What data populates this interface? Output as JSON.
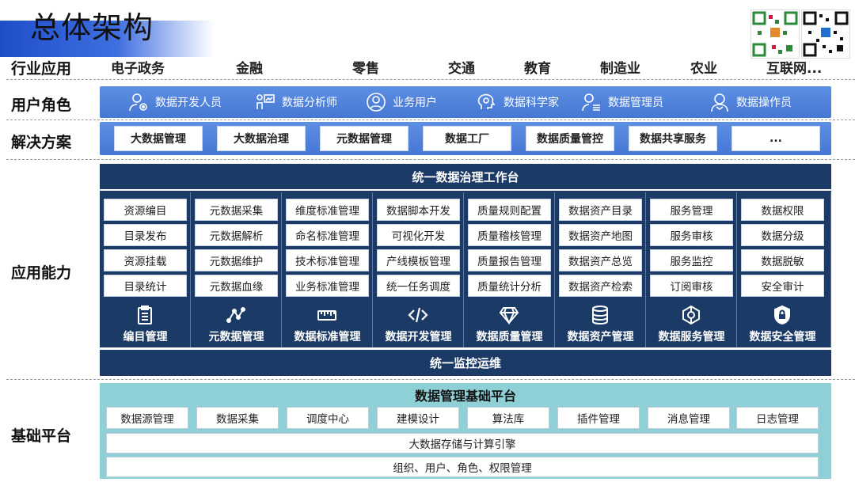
{
  "page_title": "总体架构",
  "rows": {
    "industry": "行业应用",
    "roles": "用户角色",
    "solutions": "解决方案",
    "capabilities": "应用能力",
    "platform": "基础平台"
  },
  "industry_items": [
    "电子政务",
    "金融",
    "零售",
    "交通",
    "教育",
    "制造业",
    "农业",
    "互联网..."
  ],
  "roles": [
    {
      "label": "数据开发人员",
      "icon": "developer-icon"
    },
    {
      "label": "数据分析师",
      "icon": "analyst-icon"
    },
    {
      "label": "业务用户",
      "icon": "business-user-icon"
    },
    {
      "label": "数据科学家",
      "icon": "scientist-icon"
    },
    {
      "label": "数据管理员",
      "icon": "admin-icon"
    },
    {
      "label": "数据操作员",
      "icon": "operator-icon"
    }
  ],
  "solutions": [
    "大数据管理",
    "大数据治理",
    "元数据管理",
    "数据工厂",
    "数据质量管控",
    "数据共享服务",
    "..."
  ],
  "capability": {
    "header": "统一数据治理工作台",
    "footer": "统一监控运维",
    "modules": [
      {
        "name": "编目管理",
        "icon": "clipboard-icon",
        "items": [
          "资源编目",
          "目录发布",
          "资源挂载",
          "目录统计"
        ]
      },
      {
        "name": "元数据管理",
        "icon": "graph-icon",
        "items": [
          "元数据采集",
          "元数据解析",
          "元数据维护",
          "元数据血缘"
        ]
      },
      {
        "name": "数据标准管理",
        "icon": "ruler-icon",
        "items": [
          "维度标准管理",
          "命名标准管理",
          "技术标准管理",
          "业务标准管理"
        ]
      },
      {
        "name": "数据开发管理",
        "icon": "code-icon",
        "items": [
          "数据脚本开发",
          "可视化开发",
          "产线模板管理",
          "统一任务调度"
        ]
      },
      {
        "name": "数据质量管理",
        "icon": "diamond-icon",
        "items": [
          "质量规则配置",
          "质量稽核管理",
          "质量报告管理",
          "质量统计分析"
        ]
      },
      {
        "name": "数据资产管理",
        "icon": "database-icon",
        "items": [
          "数据资产目录",
          "数据资产地图",
          "数据资产总览",
          "数据资产检索"
        ]
      },
      {
        "name": "数据服务管理",
        "icon": "service-icon",
        "items": [
          "服务管理",
          "服务审核",
          "服务监控",
          "订阅审核"
        ]
      },
      {
        "name": "数据安全管理",
        "icon": "shield-lock-icon",
        "items": [
          "数据权限",
          "数据分级",
          "数据脱敏",
          "安全审计"
        ]
      }
    ]
  },
  "platform": {
    "title": "数据管理基础平台",
    "modules": [
      "数据源管理",
      "数据采集",
      "调度中心",
      "建模设计",
      "算法库",
      "插件管理",
      "消息管理",
      "日志管理"
    ],
    "storage": "大数据存储与计算引擎",
    "org": "组织、用户、角色、权限管理"
  },
  "colors": {
    "title_band": "#2f5fd8",
    "role_bar": "#4f82dc",
    "capability_bg": "#1b3a66",
    "platform_bg": "#8fcfd6"
  }
}
